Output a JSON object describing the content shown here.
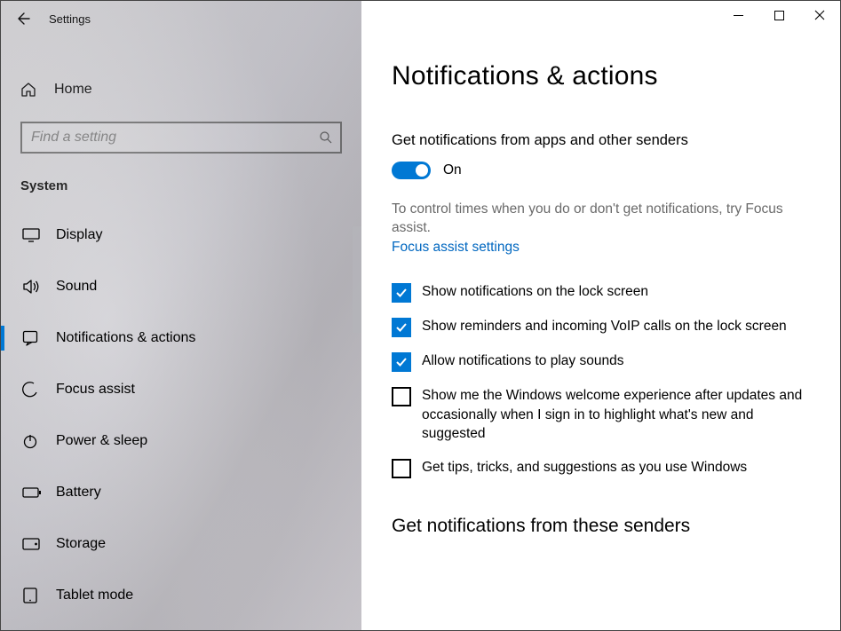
{
  "app": {
    "title": "Settings"
  },
  "sidebar": {
    "home": "Home",
    "searchPlaceholder": "Find a setting",
    "sectionLabel": "System",
    "items": [
      {
        "label": "Display"
      },
      {
        "label": "Sound"
      },
      {
        "label": "Notifications & actions"
      },
      {
        "label": "Focus assist"
      },
      {
        "label": "Power & sleep"
      },
      {
        "label": "Battery"
      },
      {
        "label": "Storage"
      },
      {
        "label": "Tablet mode"
      }
    ]
  },
  "main": {
    "title": "Notifications & actions",
    "getNotifications": {
      "label": "Get notifications from apps and other senders",
      "state": "On"
    },
    "focusDesc": "To control times when you do or don't get notifications, try Focus assist.",
    "focusLink": "Focus assist settings",
    "checks": [
      {
        "checked": true,
        "label": "Show notifications on the lock screen"
      },
      {
        "checked": true,
        "label": "Show reminders and incoming VoIP calls on the lock screen"
      },
      {
        "checked": true,
        "label": "Allow notifications to play sounds"
      },
      {
        "checked": false,
        "label": "Show me the Windows welcome experience after updates and occasionally when I sign in to highlight what's new and suggested"
      },
      {
        "checked": false,
        "label": "Get tips, tricks, and suggestions as you use Windows"
      }
    ],
    "sendersTitle": "Get notifications from these senders"
  }
}
